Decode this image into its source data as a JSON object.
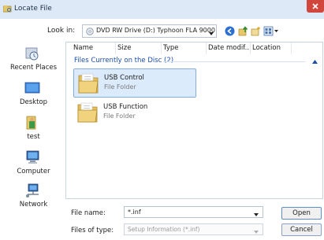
{
  "window": {
    "title": "Locate File"
  },
  "lookin": {
    "label": "Look in:",
    "value": "DVD RW Drive (D:) Typhoon FLA 9000"
  },
  "places": [
    {
      "label": "Recent Places",
      "icon": "recent-places-icon"
    },
    {
      "label": "Desktop",
      "icon": "desktop-icon"
    },
    {
      "label": "test",
      "icon": "user-folder-icon"
    },
    {
      "label": "Computer",
      "icon": "computer-icon"
    },
    {
      "label": "Network",
      "icon": "network-icon"
    }
  ],
  "columns": [
    "Name",
    "Size",
    "Type",
    "Date modif...",
    "Location"
  ],
  "group": {
    "header": "Files Currently on the Disc (2)"
  },
  "files": [
    {
      "name": "USB Control",
      "type": "File Folder",
      "selected": true
    },
    {
      "name": "USB Function",
      "type": "File Folder",
      "selected": false
    }
  ],
  "filename": {
    "label": "File name:",
    "value": "*.inf"
  },
  "filetype": {
    "label": "Files of type:",
    "value": "Setup Information (*.inf)"
  },
  "buttons": {
    "open": "Open",
    "cancel": "Cancel"
  },
  "colors": {
    "selection": "#dcebfc",
    "group_header": "#1c4fa8",
    "title_bar": "#dde9f7",
    "close": "#d2473d"
  }
}
